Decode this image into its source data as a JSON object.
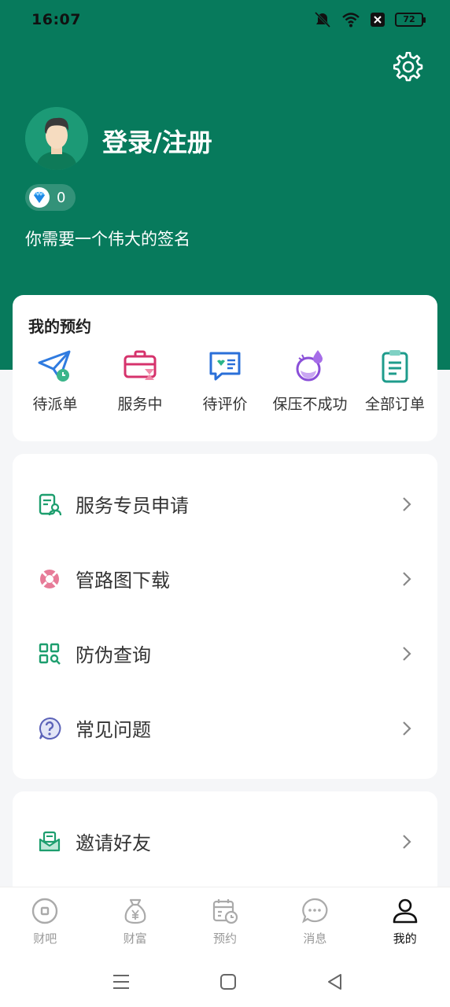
{
  "status_bar": {
    "time": "16:07",
    "battery": "72"
  },
  "profile": {
    "login_label": "登录/注册",
    "diamond_count": "0",
    "signature": "你需要一个伟大的签名"
  },
  "appointments": {
    "title": "我的预约",
    "items": [
      {
        "label": "待派单",
        "icon": "paper-plane-clock-icon"
      },
      {
        "label": "服务中",
        "icon": "briefcase-hourglass-icon"
      },
      {
        "label": "待评价",
        "icon": "review-chat-icon"
      },
      {
        "label": "保压不成功",
        "icon": "water-drop-flask-icon"
      },
      {
        "label": "全部订单",
        "icon": "clipboard-list-icon"
      }
    ]
  },
  "menu": {
    "items": [
      {
        "label": "服务专员申请",
        "icon": "document-person-icon"
      },
      {
        "label": "管路图下载",
        "icon": "lifebuoy-icon"
      },
      {
        "label": "防伪查询",
        "icon": "qr-scan-icon"
      },
      {
        "label": "常见问题",
        "icon": "question-bubble-icon"
      }
    ],
    "invite": {
      "label": "邀请好友",
      "icon": "mail-invite-icon"
    }
  },
  "bottom_nav": {
    "items": [
      {
        "label": "财吧"
      },
      {
        "label": "财富"
      },
      {
        "label": "预约"
      },
      {
        "label": "消息"
      },
      {
        "label": "我的",
        "active": true
      }
    ]
  },
  "colors": {
    "brand_green": "#077a5c",
    "icon_green": "#1d9e6e"
  }
}
